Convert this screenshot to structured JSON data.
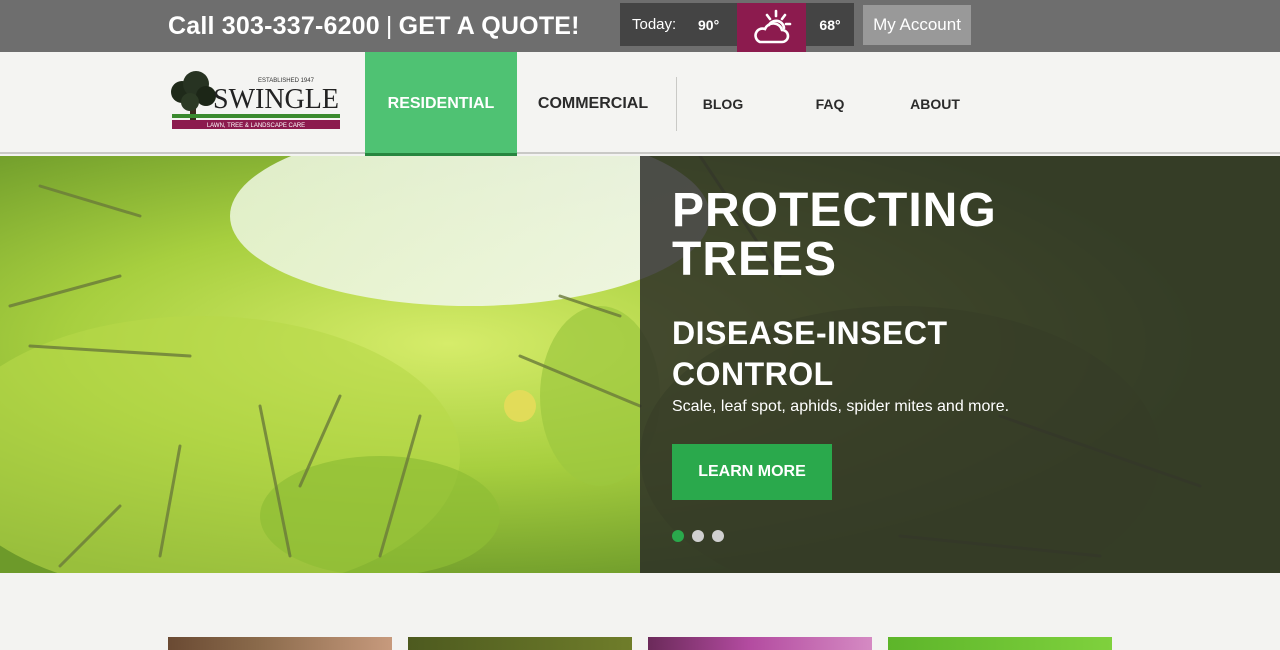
{
  "topbar": {
    "phone_text": "Call 303-337-6200",
    "separator": "|",
    "quote_text": "GET A QUOTE!",
    "weather": {
      "today_label": "Today:",
      "high": "90°",
      "icon": "partly-cloudy-icon",
      "low": "68°"
    },
    "account_label": "My Account"
  },
  "brand": {
    "established": "ESTABLISHED 1947",
    "name": "SWINGLE",
    "tagline": "LAWN, TREE & LANDSCAPE CARE"
  },
  "nav": {
    "residential": "RESIDENTIAL",
    "commercial": "COMMERCIAL",
    "blog": "BLOG",
    "faq": "FAQ",
    "about": "ABOUT"
  },
  "hero": {
    "title": "PROTECTING TREES",
    "subtitle": "DISEASE-INSECT CONTROL",
    "description": "Scale, leaf spot, aphids, spider mites and more.",
    "cta_label": "LEARN MORE",
    "active_slide": 1,
    "slide_count": 3
  },
  "colors": {
    "nav_active": "#4fc273",
    "cta_green": "#2aa94c",
    "weather_accent": "#8c1b4e",
    "topbar": "#6e6e6e"
  }
}
